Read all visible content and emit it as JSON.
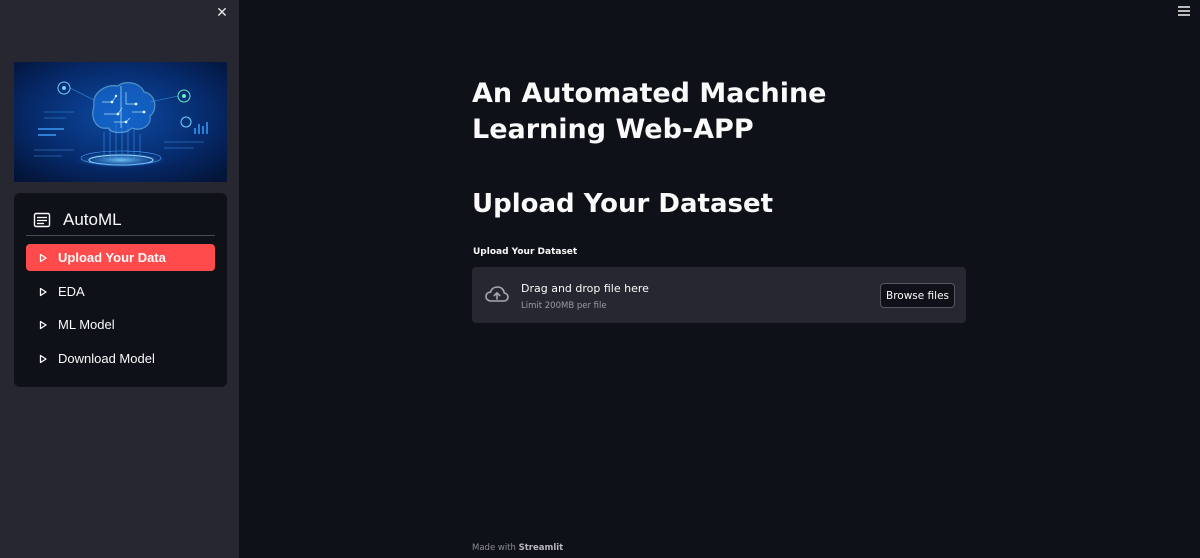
{
  "sidebar": {
    "close_icon": "close-icon",
    "menu": {
      "title": "AutoML",
      "title_icon": "list-icon",
      "items": [
        {
          "label": "Upload Your Data",
          "active": true
        },
        {
          "label": "EDA",
          "active": false
        },
        {
          "label": "ML Model",
          "active": false
        },
        {
          "label": "Download Model",
          "active": false
        }
      ]
    }
  },
  "header": {
    "menu_icon": "hamburger-icon"
  },
  "main": {
    "title": "An Automated Machine Learning Web-APP",
    "subtitle": "Upload Your Dataset",
    "uploader": {
      "label": "Upload Your Dataset",
      "drop_text": "Drag and drop file here",
      "limit_text": "Limit 200MB per file",
      "browse_label": "Browse files",
      "icon": "cloud-upload-icon"
    }
  },
  "footer": {
    "prefix": "Made with",
    "brand": "Streamlit"
  },
  "colors": {
    "background": "#0e1117",
    "sidebar": "#262730",
    "accent": "#ff4b4b",
    "text": "#fafafa"
  }
}
